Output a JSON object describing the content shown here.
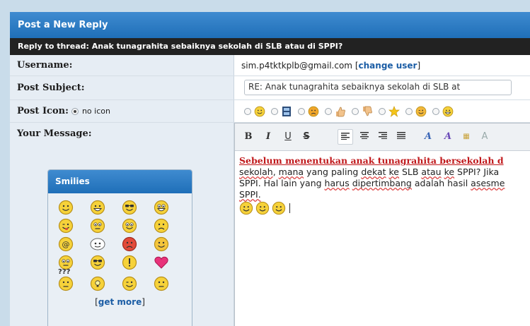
{
  "form": {
    "title": "Post a New Reply",
    "thread_line": "Reply to thread: Anak tunagrahita sebaiknya sekolah di SLB atau di SPPI?"
  },
  "username": {
    "label": "Username:",
    "value": "sim.p4tktkplb@gmail.com",
    "link_open": "[",
    "link": "change user",
    "link_close": "]"
  },
  "subject": {
    "label": "Post Subject:",
    "value": "RE: Anak tunagrahita sebaiknya sekolah di SLB at"
  },
  "post_icon": {
    "label": "Post Icon:",
    "none_label": "no icon",
    "options": [
      "smile-icon",
      "film-icon",
      "angry-icon",
      "thumbs-up-icon",
      "thumbs-down-icon",
      "star-icon",
      "wink-icon",
      "grin-icon"
    ]
  },
  "message": {
    "label": "Your Message:"
  },
  "smilies": {
    "title": "Smilies",
    "get_more_open": "[",
    "get_more": "get more",
    "get_more_close": "]",
    "items": [
      "smile",
      "big-smile",
      "cool",
      "grin",
      "wink",
      "confused",
      "tongue",
      "frown",
      "at",
      "eyes",
      "mad",
      "blush",
      "rolleyes",
      "cool-glasses",
      "exclamation",
      "heart",
      "question",
      "idea",
      "sleepy",
      "unsure"
    ],
    "question_mark_text": "???"
  },
  "editor": {
    "toolbar": [
      "B",
      "I",
      "U",
      "S",
      "align-left",
      "align-center",
      "align-right",
      "align-justify",
      "font-color",
      "font-highlight",
      "more",
      "font-size"
    ],
    "line1": "Sebelum menentukan anak tunagrahita bersekolah d",
    "line2_parts": [
      "sekolah",
      ", ",
      "mana",
      " yang paling ",
      "dekat",
      " ",
      "ke",
      " SLB ",
      "atau",
      " ",
      "ke",
      " SPPI? Jika"
    ],
    "line3_parts": [
      "SPPI. Hal lain yang ",
      "harus",
      " ",
      "dipertimbang",
      " adalah hasil ",
      "asesme"
    ],
    "line4": "SPPI.",
    "smiley_count": 3
  }
}
